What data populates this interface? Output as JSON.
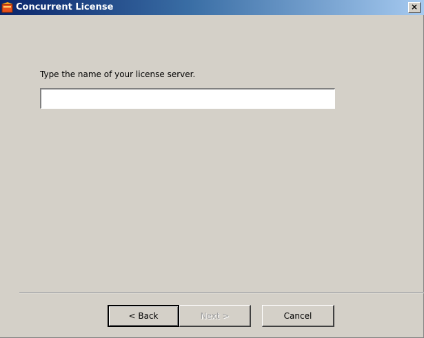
{
  "window": {
    "title": "Concurrent License",
    "close_glyph": "×",
    "icon": "app-icon"
  },
  "main": {
    "prompt": "Type the name of your license server.",
    "server_value": "",
    "server_placeholder": ""
  },
  "buttons": {
    "back": "< Back",
    "next": "Next >",
    "cancel": "Cancel"
  },
  "colors": {
    "titlebar_start": "#0a246a",
    "titlebar_end": "#a6caf0",
    "face": "#d4d0c8"
  }
}
